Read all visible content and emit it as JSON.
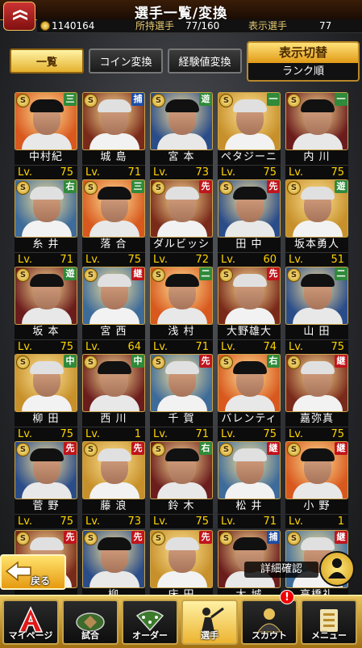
{
  "header": {
    "title": "選手一覧/変換"
  },
  "stats": {
    "coins": "1140164",
    "owned_label": "所持選手",
    "owned_value": "77/160",
    "shown_label": "表示選手",
    "shown_value": "77"
  },
  "tabs": [
    {
      "label": "一覧",
      "active": true
    },
    {
      "label": "コイン変換",
      "active": false
    },
    {
      "label": "経験値変換",
      "active": false
    }
  ],
  "display_toggle": {
    "title": "表示切替",
    "value": "ランク順"
  },
  "badge_letter": "S",
  "level_prefix": "Lv.",
  "players": [
    {
      "name": "中村紀",
      "pos": "三",
      "lv": "75",
      "color": "#2f8a3a"
    },
    {
      "name": "城 島",
      "pos": "捕",
      "lv": "71",
      "color": "#1c4ea6"
    },
    {
      "name": "宮 本",
      "pos": "遊",
      "lv": "73",
      "color": "#2f8a3a"
    },
    {
      "name": "ペタジーニ",
      "pos": "一",
      "lv": "75",
      "color": "#2f8a3a"
    },
    {
      "name": "内 川",
      "pos": "一",
      "lv": "75",
      "color": "#2f8a3a"
    },
    {
      "name": "糸 井",
      "pos": "右",
      "lv": "71",
      "color": "#2f8a3a"
    },
    {
      "name": "落 合",
      "pos": "三",
      "lv": "75",
      "color": "#2f8a3a"
    },
    {
      "name": "ダルビッシュ",
      "pos": "先",
      "lv": "72",
      "color": "#c0141c"
    },
    {
      "name": "田 中",
      "pos": "先",
      "lv": "60",
      "color": "#c0141c"
    },
    {
      "name": "坂本勇人",
      "pos": "遊",
      "lv": "51",
      "color": "#2f8a3a"
    },
    {
      "name": "坂 本",
      "pos": "遊",
      "lv": "75",
      "color": "#2f8a3a"
    },
    {
      "name": "宮 西",
      "pos": "継",
      "lv": "64",
      "color": "#c0141c"
    },
    {
      "name": "浅 村",
      "pos": "二",
      "lv": "71",
      "color": "#2f8a3a"
    },
    {
      "name": "大野雄大",
      "pos": "先",
      "lv": "74",
      "color": "#c0141c"
    },
    {
      "name": "山 田",
      "pos": "二",
      "lv": "75",
      "color": "#2f8a3a"
    },
    {
      "name": "柳 田",
      "pos": "中",
      "lv": "75",
      "color": "#2f8a3a"
    },
    {
      "name": "西 川",
      "pos": "中",
      "lv": "1",
      "color": "#2f8a3a"
    },
    {
      "name": "千 賀",
      "pos": "先",
      "lv": "71",
      "color": "#c0141c"
    },
    {
      "name": "バレンティン",
      "pos": "右",
      "lv": "75",
      "color": "#2f8a3a"
    },
    {
      "name": "嘉弥真",
      "pos": "継",
      "lv": "75",
      "color": "#c0141c"
    },
    {
      "name": "菅 野",
      "pos": "先",
      "lv": "75",
      "color": "#c0141c"
    },
    {
      "name": "藤 浪",
      "pos": "先",
      "lv": "73",
      "color": "#c0141c"
    },
    {
      "name": "鈴 木",
      "pos": "右",
      "lv": "75",
      "color": "#2f8a3a"
    },
    {
      "name": "松 井",
      "pos": "継",
      "lv": "71",
      "color": "#c0141c"
    },
    {
      "name": "小 野",
      "pos": "継",
      "lv": "1",
      "color": "#c0141c"
    },
    {
      "name": "",
      "pos": "先",
      "lv": "",
      "color": "#c0141c"
    },
    {
      "name": "柳",
      "pos": "先",
      "lv": "",
      "color": "#c0141c"
    },
    {
      "name": "床 田",
      "pos": "先",
      "lv": "",
      "color": "#c0141c"
    },
    {
      "name": "大 城",
      "pos": "捕",
      "lv": "",
      "color": "#1c4ea6"
    },
    {
      "name": "高橋礼",
      "pos": "継",
      "lv": "",
      "color": "#c0141c"
    }
  ],
  "back_label": "戻る",
  "detail_label": "詳細確認",
  "nav": [
    {
      "label": "マイページ",
      "active": false
    },
    {
      "label": "試合",
      "active": false
    },
    {
      "label": "オーダー",
      "active": false
    },
    {
      "label": "選手",
      "active": true
    },
    {
      "label": "スカウト",
      "active": false
    },
    {
      "label": "メニュー",
      "active": false
    }
  ],
  "scout_notice": "!"
}
